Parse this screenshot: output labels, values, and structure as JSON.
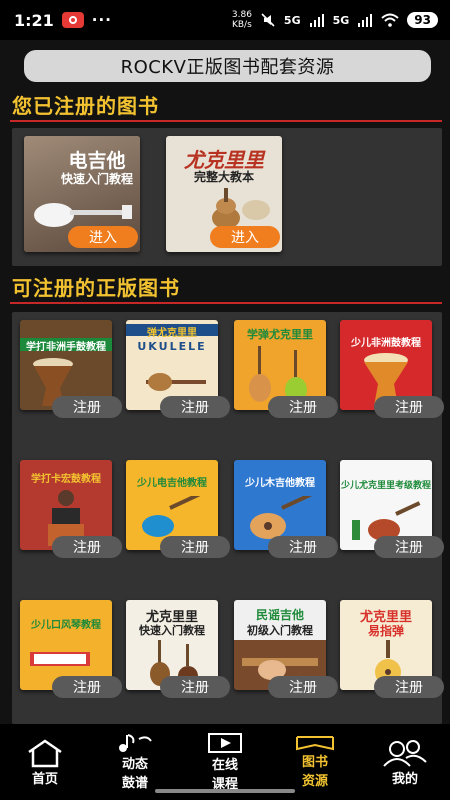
{
  "status": {
    "time": "1:21",
    "dots": "···",
    "net_speed_value": "3.86",
    "net_speed_unit": "KB/s",
    "signal1": "5G",
    "signal2": "5G",
    "battery": "93"
  },
  "header": {
    "title": "ROCKV正版图书配套资源"
  },
  "registered": {
    "section_title": "您已注册的图书",
    "books": [
      {
        "cover_title": "电吉他",
        "cover_subtitle": "快速入门教程",
        "button": "进入",
        "color": "#8a7463"
      },
      {
        "cover_title": "尤克里里",
        "cover_subtitle": "完整大教本",
        "button": "进入",
        "color": "#e8e2d6"
      }
    ]
  },
  "available": {
    "section_title": "可注册的正版图书",
    "books": [
      {
        "cover_title": "学打非洲手鼓教程",
        "button": "注册",
        "color": "#6b4a2b"
      },
      {
        "cover_title": "弹尤克里里",
        "cover_subtitle": "UKULELE",
        "button": "注册",
        "color": "#f4e6c8"
      },
      {
        "cover_title": "学弹尤克里里",
        "button": "注册",
        "color": "#f0a42b"
      },
      {
        "cover_title": "少儿非洲鼓教程",
        "button": "注册",
        "color": "#d6292b"
      },
      {
        "cover_title": "学打卡宏鼓教程",
        "button": "注册",
        "color": "#b43a2f"
      },
      {
        "cover_title": "少儿电吉他教程",
        "button": "注册",
        "color": "#f6b62b"
      },
      {
        "cover_title": "少儿木吉他教程",
        "button": "注册",
        "color": "#2f78d0"
      },
      {
        "cover_title": "少儿尤克里里考级教程",
        "button": "注册",
        "color": "#f7f7f7"
      },
      {
        "cover_title": "少儿口风琴教程",
        "button": "注册",
        "color": "#f3b12c"
      },
      {
        "cover_title": "尤克里里",
        "cover_subtitle": "快速入门教程",
        "button": "注册",
        "color": "#f4efe4"
      },
      {
        "cover_title": "民谣吉他",
        "cover_subtitle": "初级入门教程",
        "button": "注册",
        "color": "#7a4a2c"
      },
      {
        "cover_title": "尤克里里",
        "cover_subtitle": "易指弹",
        "button": "注册",
        "color": "#f5ecd3"
      }
    ]
  },
  "nav": {
    "items": [
      {
        "label": "首页",
        "icon": "home-icon"
      },
      {
        "label_line1": "动态",
        "label_line2": "鼓谱",
        "icon": "music-note-icon"
      },
      {
        "label_line1": "在线",
        "label_line2": "课程",
        "icon": "play-icon"
      },
      {
        "label_line1": "图书",
        "label_line2": "资源",
        "icon": "book-icon"
      },
      {
        "label": "我的",
        "icon": "user-icon"
      }
    ],
    "active_color": "#f2c230"
  }
}
